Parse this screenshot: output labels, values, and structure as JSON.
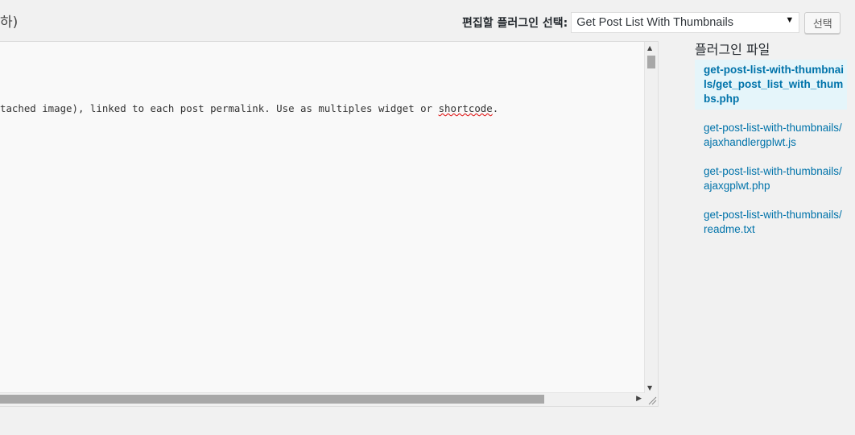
{
  "header": {
    "title_fragment": "하)",
    "select_label": "편집할 플러그인 선택:",
    "select_value": "Get Post List With Thumbnails",
    "select_button": "선택"
  },
  "editor": {
    "line_before": "tached image), linked to each post permalink. Use as multiples widget or ",
    "line_misspelled": "shortcode",
    "line_after": "."
  },
  "sidebar": {
    "heading": "플러그인 파일",
    "files": [
      {
        "label": "get-post-list-with-thumbnails/get_post_list_with_thumbs.php",
        "active": true
      },
      {
        "label": "get-post-list-with-thumbnails/ajaxhandlergplwt.js",
        "active": false
      },
      {
        "label": "get-post-list-with-thumbnails/ajaxgplwt.php",
        "active": false
      },
      {
        "label": "get-post-list-with-thumbnails/readme.txt",
        "active": false
      }
    ]
  }
}
